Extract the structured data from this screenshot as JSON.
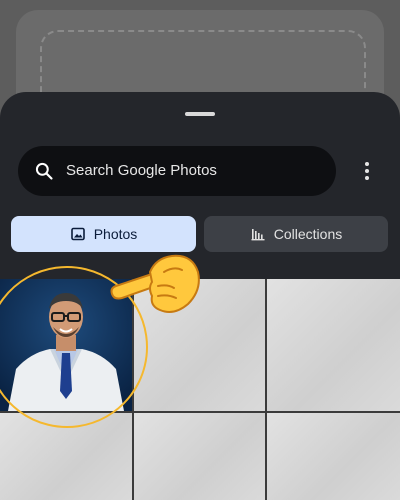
{
  "search": {
    "placeholder": "Search Google Photos"
  },
  "tabs": [
    {
      "label": "Photos",
      "icon": "image-icon",
      "selected": true
    },
    {
      "label": "Collections",
      "icon": "collections-icon",
      "selected": false
    }
  ],
  "colors": {
    "sheet": "#24262b",
    "search_bar": "#0e0f12",
    "tab_selected": "#d3e3fd",
    "tab_unselected": "#3d4046",
    "highlight": "#f5b82e"
  },
  "grid": {
    "items": [
      {
        "type": "portrait-photo",
        "highlighted": true
      },
      {
        "type": "blank-photo"
      },
      {
        "type": "blank-photo"
      },
      {
        "type": "blank-photo"
      },
      {
        "type": "blank-photo"
      },
      {
        "type": "blank-photo"
      }
    ]
  },
  "overlay": {
    "annotation_icon": "pointing-hand-emoji"
  }
}
